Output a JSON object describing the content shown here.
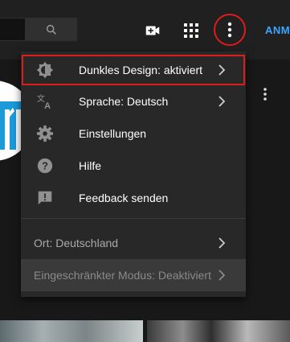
{
  "header": {
    "search_placeholder": "",
    "signin_label": "ANM"
  },
  "menu": {
    "items": [
      {
        "label": "Dunkles Design: aktiviert",
        "icon": "dark-theme-icon",
        "has_submenu": true
      },
      {
        "label": "Sprache: Deutsch",
        "icon": "translate-icon",
        "has_submenu": true
      },
      {
        "label": "Einstellungen",
        "icon": "gear-icon",
        "has_submenu": false
      },
      {
        "label": "Hilfe",
        "icon": "help-icon",
        "has_submenu": false
      },
      {
        "label": "Feedback senden",
        "icon": "feedback-icon",
        "has_submenu": false
      }
    ],
    "lower_items": [
      {
        "label": "Ort: Deutschland",
        "has_submenu": true
      },
      {
        "label": "Eingeschränkter Modus: Deaktiviert",
        "has_submenu": true
      }
    ]
  },
  "colors": {
    "accent": "#3ea6ff",
    "highlight_outline": "#e01b1b",
    "menu_bg": "#282828",
    "topbar_bg": "#202020"
  }
}
